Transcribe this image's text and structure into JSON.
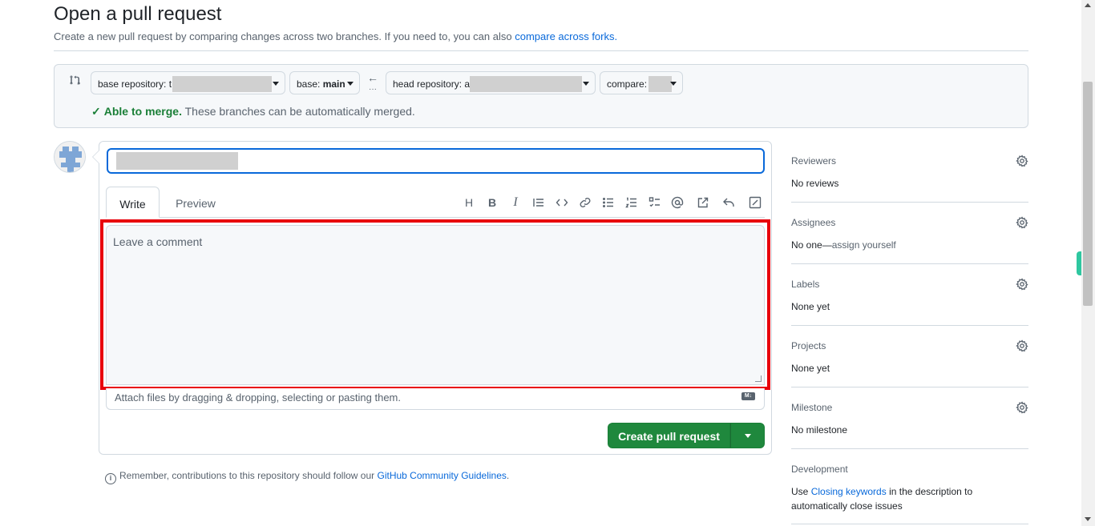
{
  "header": {
    "title": "Open a pull request",
    "subtitle": "Create a new pull request by comparing changes across two branches. If you need to, you can also",
    "forks_link": "compare across forks."
  },
  "compare": {
    "base_repo_label": "base repository: t",
    "base_label": "base:",
    "base_value": "main",
    "head_repo_label": "head repository: a",
    "compare_label": "compare:",
    "merge_status": "Able to merge.",
    "merge_message": "These branches can be automatically merged."
  },
  "form": {
    "title_value": "",
    "tabs": {
      "write": "Write",
      "preview": "Preview"
    },
    "comment_placeholder": "Leave a comment",
    "attach_text": "Attach files by dragging & dropping, selecting or pasting them.",
    "md_badge": "M↓",
    "submit_label": "Create pull request"
  },
  "toolbar": {
    "heading": "H",
    "bold": "B",
    "italic": "I"
  },
  "reminder": {
    "text": "Remember, contributions to this repository should follow our",
    "link": "GitHub Community Guidelines",
    "end": "."
  },
  "sidebar": {
    "reviewers": {
      "title": "Reviewers",
      "value": "No reviews"
    },
    "assignees": {
      "title": "Assignees",
      "value": "No one—",
      "link": "assign yourself"
    },
    "labels": {
      "title": "Labels",
      "value": "None yet"
    },
    "projects": {
      "title": "Projects",
      "value": "None yet"
    },
    "milestone": {
      "title": "Milestone",
      "value": "No milestone"
    },
    "development": {
      "title": "Development",
      "pre": "Use",
      "link": "Closing keywords",
      "post": "in the description to automatically close issues"
    }
  },
  "colors": {
    "accent": "#0969da",
    "success": "#1f883d",
    "highlight": "#e8000b"
  }
}
